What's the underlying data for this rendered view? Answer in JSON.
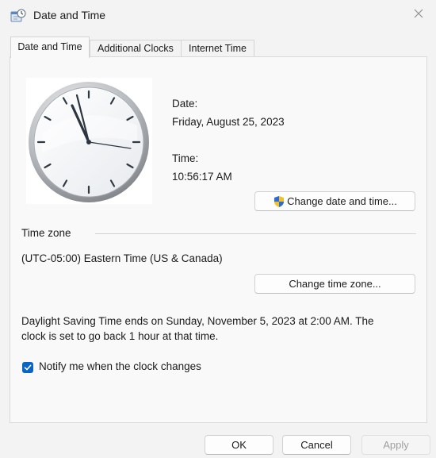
{
  "window": {
    "title": "Date and Time",
    "accent_color": "#0a64c4"
  },
  "tabs": [
    {
      "label": "Date and Time",
      "active": true
    },
    {
      "label": "Additional Clocks",
      "active": false
    },
    {
      "label": "Internet Time",
      "active": false
    }
  ],
  "datetime": {
    "date_label": "Date:",
    "date_value": "Friday, August 25, 2023",
    "time_label": "Time:",
    "time_value": "10:56:17 AM",
    "change_button": "Change date and time..."
  },
  "timezone": {
    "section_label": "Time zone",
    "value": "(UTC-05:00) Eastern Time (US & Canada)",
    "change_button": "Change time zone..."
  },
  "dst": {
    "line1": "Daylight Saving Time ends on Sunday, November 5, 2023 at 2:00 AM. The",
    "line2": "clock is set to go back 1 hour at that time."
  },
  "notify": {
    "label": "Notify me when the clock changes",
    "checked": true
  },
  "footer": {
    "ok": "OK",
    "cancel": "Cancel",
    "apply": "Apply"
  },
  "icons": {
    "app": "date-time-app-icon",
    "close": "close-icon",
    "shield": "uac-shield-icon",
    "check": "checkmark-icon"
  }
}
